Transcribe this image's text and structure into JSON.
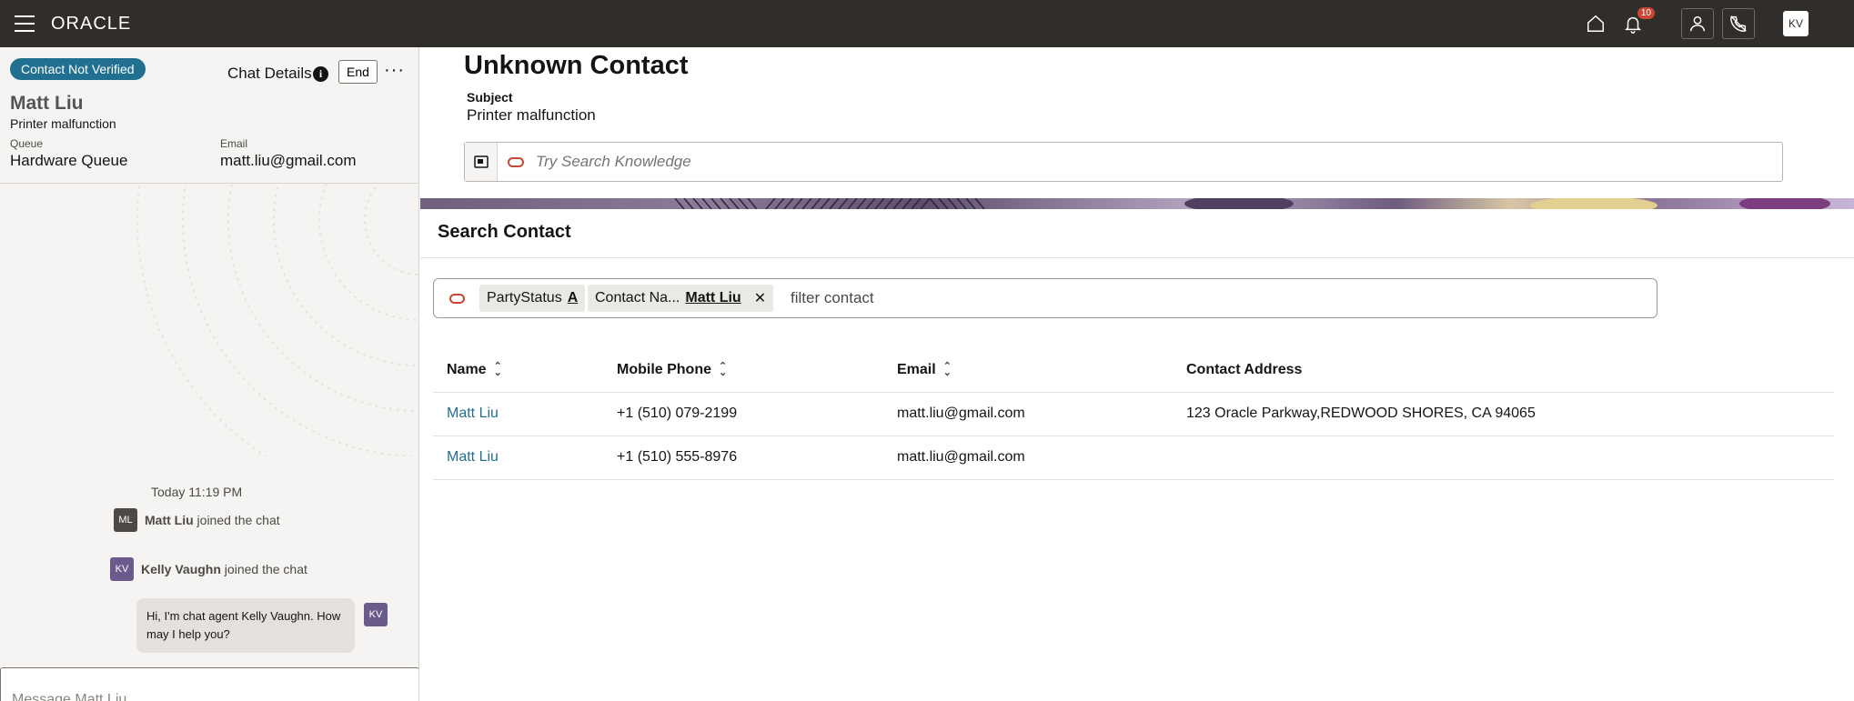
{
  "topbar": {
    "logo": "ORACLE",
    "notifications_count": "10",
    "avatar_initials": "KV"
  },
  "left": {
    "status_pill": "Contact Not Verified",
    "chat_details_label": "Chat Details",
    "info_glyph": "i",
    "end_button": "End",
    "more_glyph": "···",
    "customer_name": "Matt Liu",
    "customer_issue": "Printer malfunction",
    "queue_label": "Queue",
    "queue_value": "Hardware Queue",
    "email_label": "Email",
    "email_value": "matt.liu@gmail.com",
    "chat_time": "Today 11:19 PM",
    "events": [
      {
        "initials": "ML",
        "name": "Matt Liu",
        "text": " joined the chat"
      },
      {
        "initials": "KV",
        "name": "Kelly Vaughn",
        "text": " joined the chat"
      }
    ],
    "agent_message": "Hi, I'm chat agent Kelly Vaughn. How may I help you?",
    "agent_initials": "KV",
    "message_placeholder": "Message Matt Liu"
  },
  "main": {
    "title": "Unknown Contact",
    "subject_label": "Subject",
    "subject_value": "Printer malfunction",
    "knowledge_placeholder": "Try Search Knowledge",
    "search_contact_header": "Search Contact",
    "chips": [
      {
        "label": "PartyStatus",
        "value": "A"
      },
      {
        "label": "Contact Na...",
        "value": "Matt Liu"
      }
    ],
    "chip_remove": "✕",
    "filter_value": "filter contact",
    "table": {
      "columns": [
        "Name",
        "Mobile Phone",
        "Email",
        "Contact Address"
      ],
      "rows": [
        [
          "Matt Liu",
          "+1 (510) 079-2199",
          "matt.liu@gmail.com",
          "123 Oracle Parkway,REDWOOD SHORES, CA 94065"
        ],
        [
          "Matt Liu",
          "+1 (510) 555-8976",
          "matt.liu@gmail.com",
          ""
        ]
      ]
    }
  },
  "colors": {
    "topbar": "#312d2a",
    "accent_blue": "#227091",
    "oracle_red": "#c74634",
    "agent_avatar": "#6b5b8c"
  },
  "icons": [
    "menu-icon",
    "home-icon",
    "bell-icon",
    "user-icon",
    "phone-disconnect-icon",
    "info-icon",
    "more-icon",
    "knowledge-icon",
    "sort-icon",
    "close-icon"
  ]
}
